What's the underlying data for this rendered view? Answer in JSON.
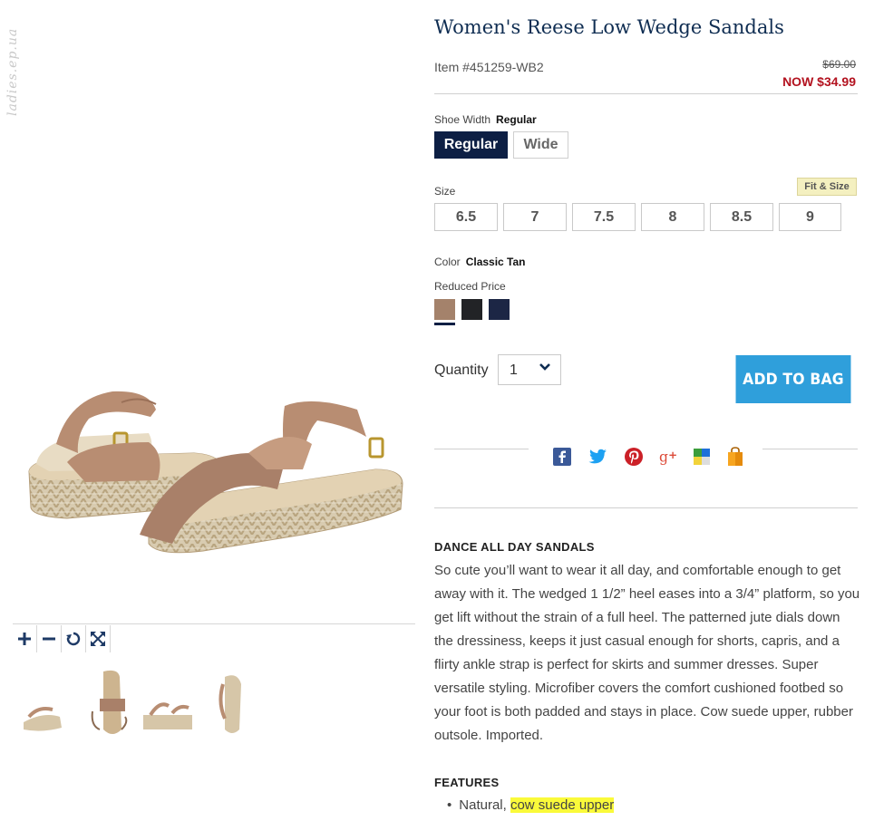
{
  "watermark": "ladies.ep.ua",
  "product": {
    "title": "Women's Reese Low Wedge Sandals",
    "item_number": "Item #451259-WB2",
    "old_price": "$69.00",
    "now_price": "NOW $34.99"
  },
  "width": {
    "label": "Shoe Width",
    "selected": "Regular",
    "options": [
      "Regular",
      "Wide"
    ]
  },
  "size": {
    "label": "Size",
    "fit_link": "Fit & Size",
    "options": [
      "6.5",
      "7",
      "7.5",
      "8",
      "8.5",
      "9"
    ]
  },
  "color": {
    "label": "Color",
    "selected": "Classic Tan",
    "note": "Reduced Price",
    "swatches": [
      {
        "name": "Classic Tan",
        "hex": "#a4826b"
      },
      {
        "name": "Black",
        "hex": "#222326"
      },
      {
        "name": "Navy",
        "hex": "#1c2645"
      }
    ]
  },
  "quantity": {
    "label": "Quantity",
    "value": "1"
  },
  "add_to_bag": "ADD TO BAG",
  "share_icons": [
    "facebook-icon",
    "twitter-icon",
    "pinterest-icon",
    "google-plus-icon",
    "delicious-icon",
    "shopping-bag-icon"
  ],
  "zoom_controls": [
    "zoom-in-icon",
    "zoom-out-icon",
    "reset-icon",
    "fullscreen-icon"
  ],
  "description": {
    "heading": "DANCE ALL DAY SANDALS",
    "body": "So cute you’ll want to wear it all day, and comfortable enough to get away with it. The wedged 1 1/2” heel eases into a 3/4” platform, so you get lift without the strain of a full heel. The patterned jute dials down the dressiness, keeps it just casual enough for shorts, capris, and a flirty ankle strap is perfect for skirts and summer dresses. Super versatile styling. Microfiber covers the comfort cushioned footbed so your foot is both padded and stays in place. Cow suede upper, rubber outsole. Imported."
  },
  "features": {
    "heading": "FEATURES",
    "items": [
      {
        "prefix": "Natural,",
        "highlight": "cow suede upper"
      }
    ]
  },
  "colors": {
    "navy": "#0d1f44",
    "title": "#0f2d52",
    "sale_red": "#b3121f",
    "cta_blue": "#2f9fdb",
    "highlight": "#fafa3a"
  }
}
